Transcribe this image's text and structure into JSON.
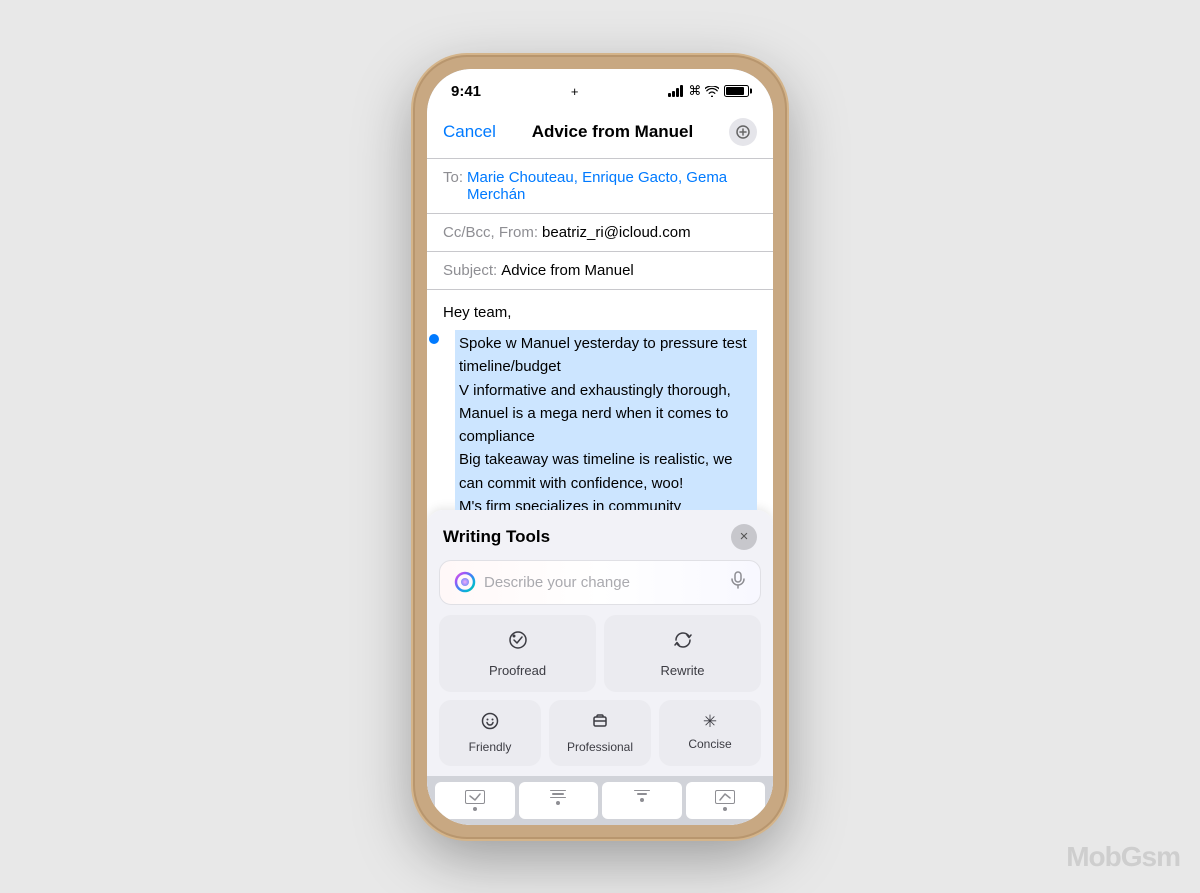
{
  "phone": {
    "status_bar": {
      "time": "9:41",
      "center_icon": "+"
    },
    "mail": {
      "cancel_label": "Cancel",
      "title": "Advice from Manuel",
      "to_label": "To:",
      "to_recipients": "Marie Chouteau, Enrique Gacto, Gema Merchán",
      "cc_label": "Cc/Bcc, From:",
      "cc_value": "beatriz_ri@icloud.com",
      "subject_label": "Subject:",
      "subject_value": "Advice from Manuel",
      "body_greeting": "Hey team,",
      "body_selected_text": "Spoke w Manuel yesterday to pressure test timeline/budget\nV informative and exhaustingly thorough, Manuel is a mega nerd when it comes to compliance\nBig takeaway was timeline is realistic, we can commit with confidence, woo!\nM's firm specializes in community consultation, we need help here, should consider engaging them for compliance if we can budget it"
    },
    "writing_tools": {
      "title": "Writing Tools",
      "close_label": "×",
      "input_placeholder": "Describe your change",
      "proofread_label": "Proofread",
      "rewrite_label": "Rewrite",
      "friendly_label": "Friendly",
      "professional_label": "Professional",
      "concise_label": "Concise"
    }
  },
  "watermark": "MobGsm"
}
